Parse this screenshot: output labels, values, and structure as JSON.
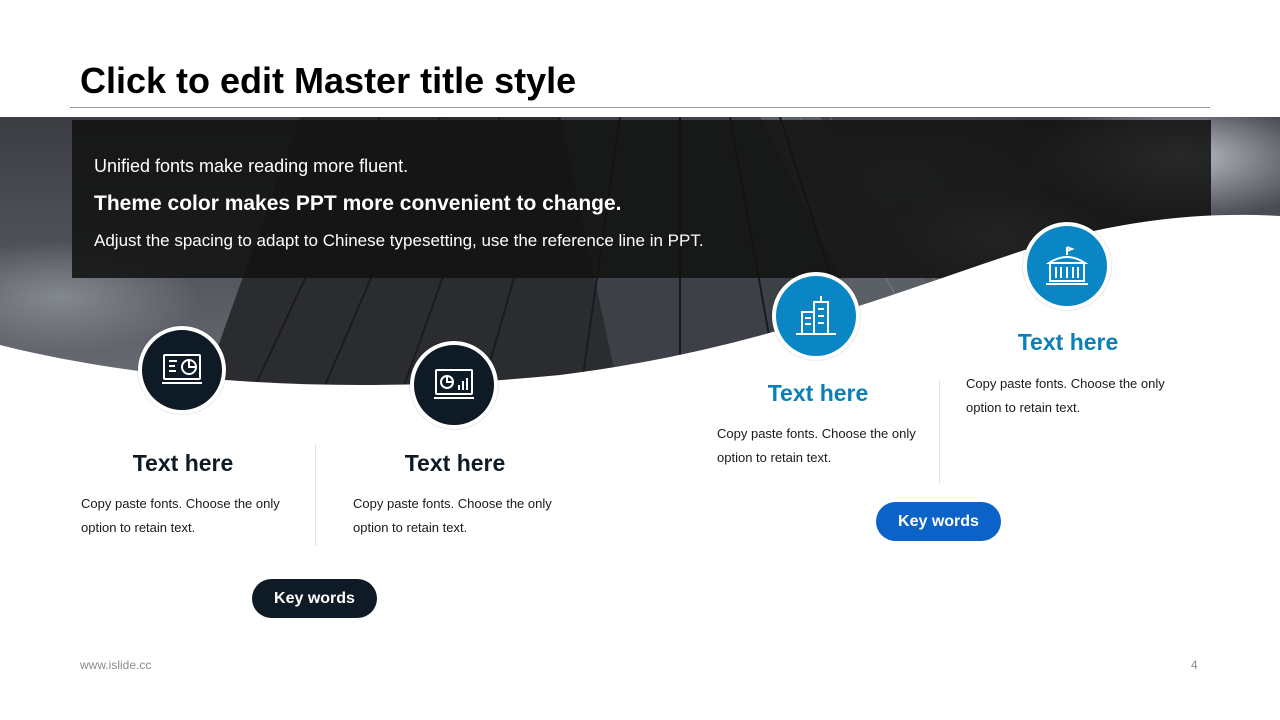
{
  "slide": {
    "title": "Click to edit Master title style",
    "intro": {
      "line1": "Unified fonts make reading more fluent.",
      "line2": "Theme color makes PPT more convenient to change.",
      "line3": "Adjust the spacing to adapt to Chinese typesetting, use the reference line in PPT."
    },
    "cards": [
      {
        "icon": "presentation-chart-icon",
        "title": "Text here",
        "body": "Copy paste fonts. Choose the only option to retain text."
      },
      {
        "icon": "analytics-screen-icon",
        "title": "Text here",
        "body": "Copy paste fonts. Choose the only option to retain text."
      },
      {
        "icon": "office-buildings-icon",
        "title": "Text here",
        "body": "Copy paste fonts. Choose the only option to retain text."
      },
      {
        "icon": "government-building-icon",
        "title": "Text here",
        "body": "Copy paste fonts. Choose the only option to retain text."
      }
    ],
    "buttons": {
      "left": "Key words",
      "right": "Key words"
    },
    "footer": {
      "url": "www.islide.cc",
      "page": "4"
    },
    "colors": {
      "dark": "#0e1a26",
      "blue": "#0b86c4",
      "button_blue": "#0b63c8"
    }
  }
}
